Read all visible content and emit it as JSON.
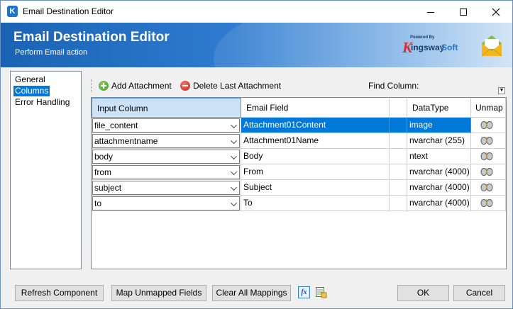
{
  "window": {
    "title": "Email Destination Editor",
    "app_icon_letter": "K"
  },
  "banner": {
    "title": "Email Destination Editor",
    "subtitle": "Perform Email action",
    "logo_powered": "Powered By",
    "logo_k": "K",
    "logo_ingsway": "ingsway",
    "logo_soft": "Soft"
  },
  "nav": {
    "items": [
      {
        "label": "General",
        "selected": false
      },
      {
        "label": "Columns",
        "selected": true
      },
      {
        "label": "Error Handling",
        "selected": false
      }
    ]
  },
  "toolbar": {
    "add_label": "Add Attachment",
    "delete_label": "Delete Last Attachment",
    "find_label": "Find Column:",
    "find_value": ""
  },
  "grid": {
    "headers": {
      "input": "Input Column",
      "field": "Email Field",
      "blank": "",
      "dtype": "DataType",
      "unmap": "Unmap"
    },
    "rows": [
      {
        "input": "file_content",
        "field": "Attachment01Content",
        "dtype": "image"
      },
      {
        "input": "attachmentname",
        "field": "Attachment01Name",
        "dtype": "nvarchar (255)"
      },
      {
        "input": "body",
        "field": "Body",
        "dtype": "ntext"
      },
      {
        "input": "from",
        "field": "From",
        "dtype": "nvarchar (4000)"
      },
      {
        "input": "subject",
        "field": "Subject",
        "dtype": "nvarchar (4000)"
      },
      {
        "input": "to",
        "field": "To",
        "dtype": "nvarchar (4000)"
      }
    ],
    "selected_row": 0
  },
  "buttons": {
    "refresh": "Refresh Component",
    "map_unmapped": "Map Unmapped Fields",
    "clear_all": "Clear All Mappings",
    "fx": "fx",
    "ok": "OK",
    "cancel": "Cancel"
  },
  "colors": {
    "accent": "#0078d7",
    "banner_start": "#1a63b4",
    "banner_end": "#cfe2f6"
  }
}
